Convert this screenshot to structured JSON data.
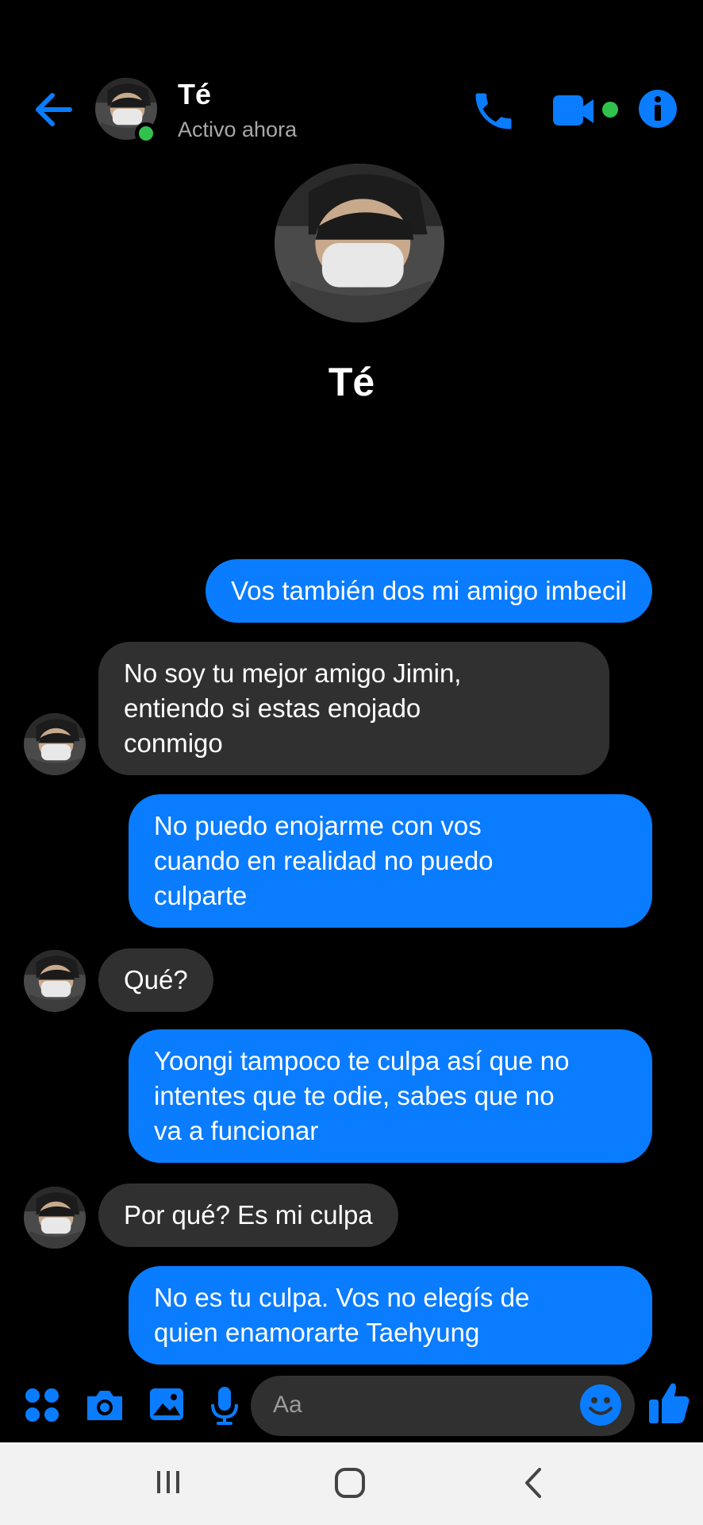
{
  "header": {
    "contact_name": "Té",
    "status": "Activo ahora",
    "icons": [
      "back-arrow-icon",
      "phone-icon",
      "video-camera-icon",
      "info-icon"
    ],
    "accent_color": "#0a7cff",
    "online_color": "#31c24d"
  },
  "profile": {
    "name": "Té"
  },
  "messages": [
    {
      "from": "me",
      "text": "Vos también dos mi amigo imbecil"
    },
    {
      "from": "them",
      "lines": [
        "No soy tu mejor amigo Jimin,",
        "entiendo si estas enojado",
        "conmigo"
      ]
    },
    {
      "from": "me",
      "lines": [
        "No puedo enojarme con vos",
        "cuando en realidad no puedo",
        "culparte"
      ]
    },
    {
      "from": "them",
      "text": "Qué?"
    },
    {
      "from": "me",
      "lines": [
        "Yoongi tampoco te culpa así que no",
        "intentes que te odie, sabes que no",
        "va a funcionar"
      ]
    },
    {
      "from": "them",
      "text": "Por qué? Es mi culpa"
    },
    {
      "from": "me",
      "lines": [
        "No es tu culpa. Vos no elegís de",
        "quien enamorarte Taehyung"
      ]
    }
  ],
  "composer": {
    "placeholder": "Aa",
    "icons": [
      "apps-grid-icon",
      "camera-icon",
      "gallery-icon",
      "microphone-icon",
      "emoji-icon",
      "thumbs-up-icon"
    ]
  },
  "navbar": {
    "icons": [
      "recent-apps-icon",
      "home-icon",
      "back-icon"
    ]
  }
}
